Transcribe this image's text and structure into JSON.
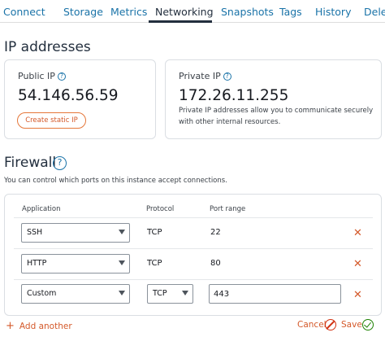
{
  "tabs": [
    {
      "label": "Connect",
      "active": false
    },
    {
      "label": "Storage",
      "active": false
    },
    {
      "label": "Metrics",
      "active": false
    },
    {
      "label": "Networking",
      "active": true
    },
    {
      "label": "Snapshots",
      "active": false
    },
    {
      "label": "Tags",
      "active": false
    },
    {
      "label": "History",
      "active": false
    },
    {
      "label": "Delete",
      "active": false
    }
  ],
  "ip_section": {
    "title": "IP addresses",
    "public": {
      "label": "Public IP",
      "value": "54.146.56.59",
      "button": "Create static IP"
    },
    "private": {
      "label": "Private IP",
      "value": "172.26.11.255",
      "description": "Private IP addresses allow you to communicate securely with other internal resources."
    }
  },
  "firewall": {
    "title": "Firewall",
    "help": "?",
    "description": "You can control which ports on this instance accept connections.",
    "headers": {
      "application": "Application",
      "protocol": "Protocol",
      "port_range": "Port range"
    },
    "rows": [
      {
        "application": "SSH",
        "protocol": "TCP",
        "port": "22"
      },
      {
        "application": "HTTP",
        "protocol": "TCP",
        "port": "80"
      },
      {
        "application": "Custom",
        "protocol": "TCP",
        "port": "443"
      }
    ],
    "remove_symbol": "✕",
    "add_label": "Add another",
    "add_symbol": "+",
    "cancel_label": "Cancel",
    "save_label": "Save"
  },
  "colors": {
    "accent": "#d4592a",
    "link": "#1a73a8",
    "text": "#232f3e",
    "cancel_icon": "#d13212",
    "save_icon": "#1d8102"
  },
  "icons": {
    "help": "question-circle-icon",
    "remove": "close-icon",
    "dropdown": "caret-down-icon",
    "cancel": "prohibited-icon",
    "save": "check-circle-icon"
  }
}
